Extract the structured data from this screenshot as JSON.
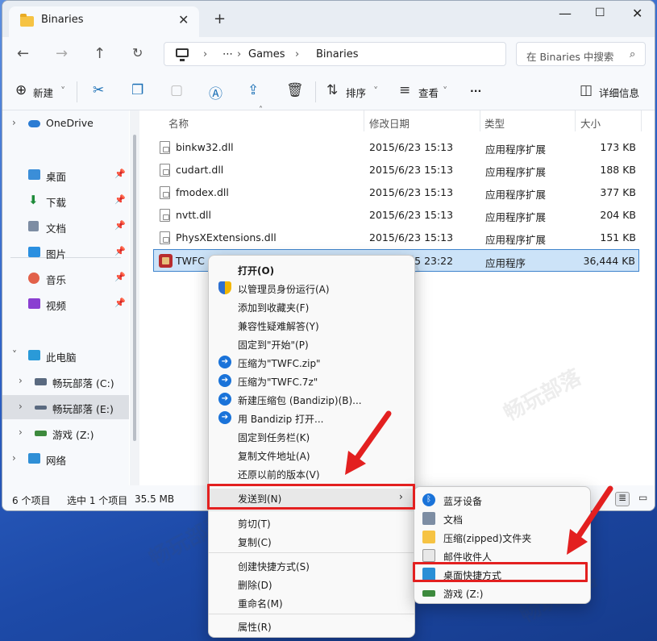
{
  "window": {
    "tab_title": "Binaries"
  },
  "address": {
    "crumbs": [
      "Games",
      "Binaries"
    ],
    "ellipsis": "⋯",
    "search_placeholder": "在 Binaries 中搜索"
  },
  "toolbar": {
    "new": "新建",
    "sort": "排序",
    "view": "查看",
    "more": "···",
    "details": "详细信息"
  },
  "sidebar": [
    {
      "label": "OneDrive"
    },
    {
      "label": "桌面"
    },
    {
      "label": "下载"
    },
    {
      "label": "文档"
    },
    {
      "label": "图片"
    },
    {
      "label": "音乐"
    },
    {
      "label": "视频"
    },
    {
      "label": "此电脑"
    },
    {
      "label": "畅玩部落 (C:)"
    },
    {
      "label": "畅玩部落 (E:)"
    },
    {
      "label": "游戏 (Z:)"
    },
    {
      "label": "网络"
    }
  ],
  "columns": {
    "name": "名称",
    "date": "修改日期",
    "type": "类型",
    "size": "大小"
  },
  "files": [
    {
      "name": "binkw32.dll",
      "date": "2015/6/23 15:13",
      "type": "应用程序扩展",
      "size": "173 KB"
    },
    {
      "name": "cudart.dll",
      "date": "2015/6/23 15:13",
      "type": "应用程序扩展",
      "size": "188 KB"
    },
    {
      "name": "fmodex.dll",
      "date": "2015/6/23 15:13",
      "type": "应用程序扩展",
      "size": "377 KB"
    },
    {
      "name": "nvtt.dll",
      "date": "2015/6/23 15:13",
      "type": "应用程序扩展",
      "size": "204 KB"
    },
    {
      "name": "PhysXExtensions.dll",
      "date": "2015/6/23 15:13",
      "type": "应用程序扩展",
      "size": "151 KB"
    },
    {
      "name": "TWFC",
      "date": "2015/6/25 23:22",
      "type": "应用程序",
      "size": "36,444 KB"
    }
  ],
  "status": {
    "count": "6 个项目",
    "selected": "选中 1 个项目",
    "size": "35.5 MB"
  },
  "context_menu": [
    "打开(O)",
    "以管理员身份运行(A)",
    "添加到收藏夹(F)",
    "兼容性疑难解答(Y)",
    "固定到\"开始\"(P)",
    "压缩为\"TWFC.zip\"",
    "压缩为\"TWFC.7z\"",
    "新建压缩包 (Bandizip)(B)...",
    "用 Bandizip 打开...",
    "固定到任务栏(K)",
    "复制文件地址(A)",
    "还原以前的版本(V)",
    "发送到(N)",
    "剪切(T)",
    "复制(C)",
    "创建快捷方式(S)",
    "删除(D)",
    "重命名(M)",
    "属性(R)"
  ],
  "sendto_menu": [
    "蓝牙设备",
    "文档",
    "压缩(zipped)文件夹",
    "邮件收件人",
    "桌面快捷方式",
    "游戏 (Z:)"
  ],
  "watermark": "畅玩部落",
  "colors": {
    "accent": "#1a6fb5",
    "highlight": "#e32020",
    "selection": "#cce3f8"
  }
}
